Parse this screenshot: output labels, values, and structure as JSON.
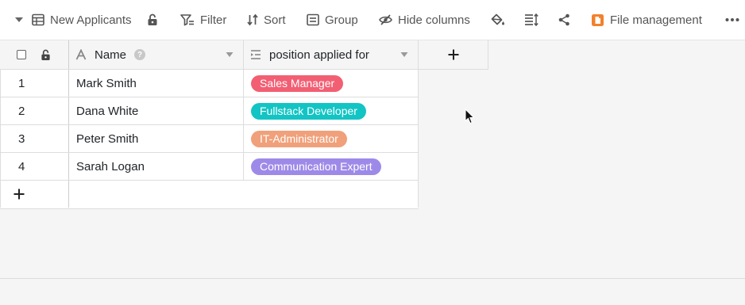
{
  "toolbar": {
    "table_name": "New Applicants",
    "filter_label": "Filter",
    "sort_label": "Sort",
    "group_label": "Group",
    "hide_columns_label": "Hide columns",
    "file_management_label": "File management"
  },
  "grid": {
    "columns": [
      {
        "title": "Name",
        "type_icon": "text-type-icon"
      },
      {
        "title": "position applied for",
        "type_icon": "single-select-type-icon"
      }
    ],
    "rows": [
      {
        "index": "1",
        "name": "Mark Smith",
        "position": "Sales Manager",
        "color": "#f25f73"
      },
      {
        "index": "2",
        "name": "Dana White",
        "position": "Fullstack Developer",
        "color": "#13c4c4"
      },
      {
        "index": "3",
        "name": "Peter Smith",
        "position": "IT-Administrator",
        "color": "#f0a07a"
      },
      {
        "index": "4",
        "name": "Sarah Logan",
        "position": "Communication Expert",
        "color": "#9d8ae8"
      }
    ]
  },
  "colors": {
    "accent_file": "#f2812b",
    "icon_gray": "#555555",
    "canvas": "#f5f5f5"
  }
}
